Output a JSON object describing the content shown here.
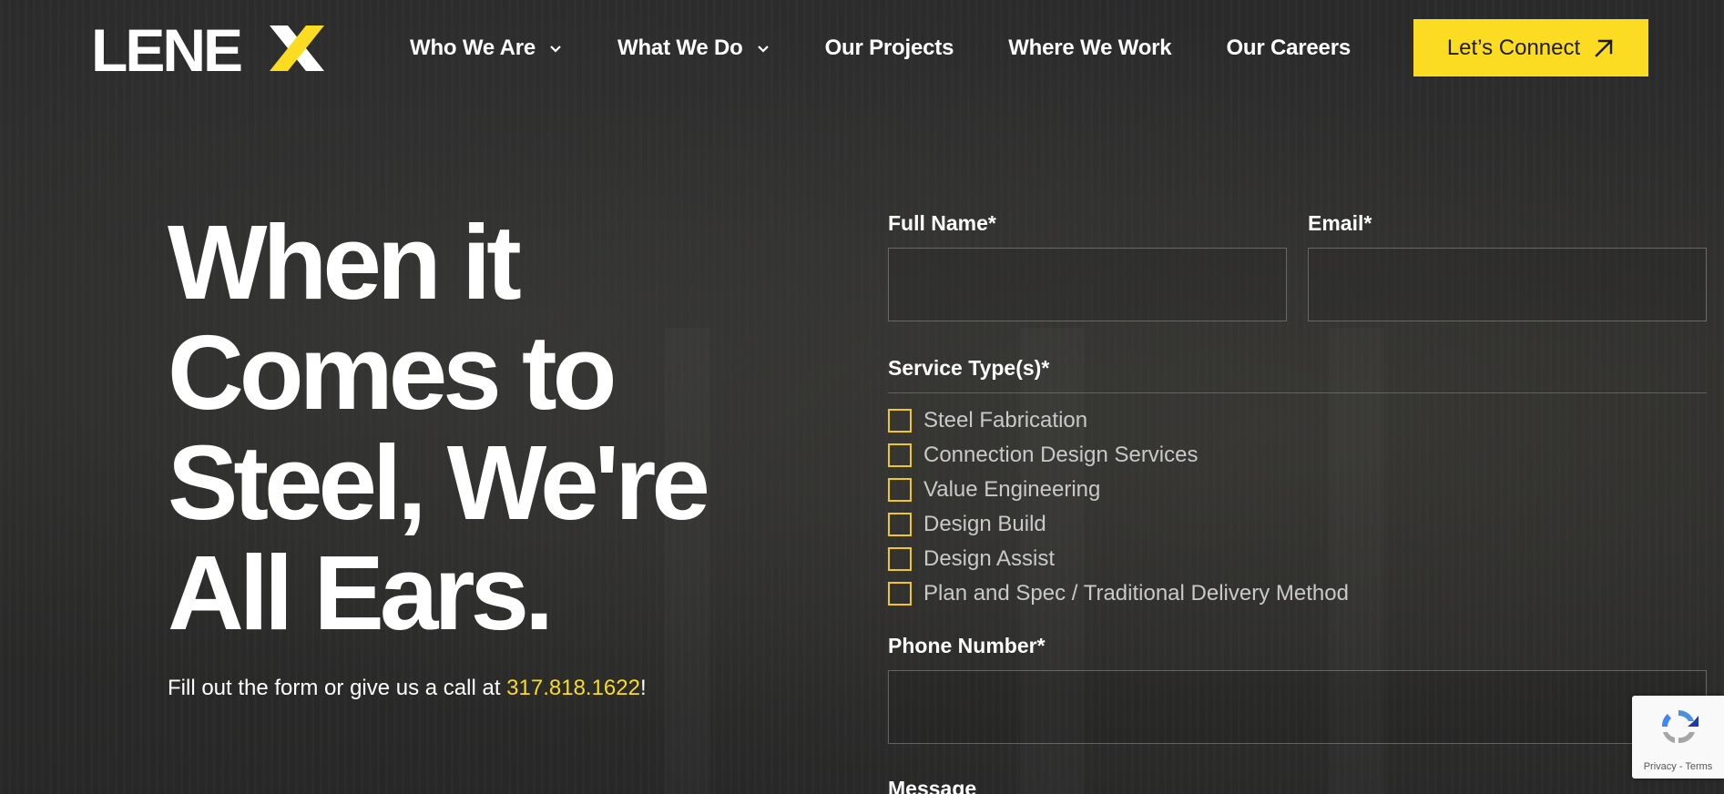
{
  "brand": {
    "logo_text": "LENEX",
    "accent_color": "#fbdc23",
    "background_color": "#2a2a2b"
  },
  "nav": {
    "items": [
      {
        "label": "Who We Are",
        "has_dropdown": true
      },
      {
        "label": "What We Do",
        "has_dropdown": true
      },
      {
        "label": "Our Projects",
        "has_dropdown": false
      },
      {
        "label": "Where We Work",
        "has_dropdown": false
      },
      {
        "label": "Our Careers",
        "has_dropdown": false
      }
    ],
    "cta_label": "Let’s Connect",
    "cta_icon": "arrow-up-right-icon"
  },
  "hero": {
    "title_lines": [
      "When it",
      "Comes to",
      "Steel, We're",
      "All Ears."
    ],
    "subtitle_before": "Fill out the form or give us a call at ",
    "phone": "317.818.1622",
    "subtitle_after": "!"
  },
  "form": {
    "full_name_label": "Full Name*",
    "email_label": "Email*",
    "service_label": "Service Type(s)*",
    "services": [
      "Steel Fabrication",
      "Connection Design Services",
      "Value Engineering",
      "Design Build",
      "Design Assist",
      "Plan and Spec / Traditional Delivery Method"
    ],
    "phone_label": "Phone Number*",
    "message_label": "Message"
  },
  "recaptcha": {
    "links": "Privacy - Terms"
  }
}
